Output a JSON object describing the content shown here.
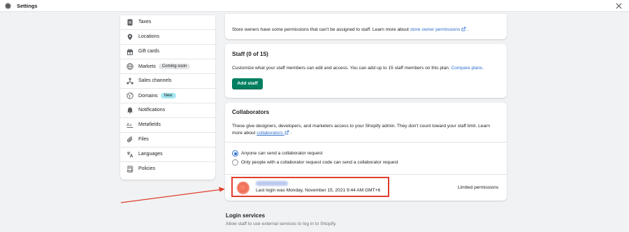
{
  "header": {
    "title": "Settings"
  },
  "sidebar": {
    "items": [
      {
        "label": "Taxes",
        "badge": null
      },
      {
        "label": "Locations",
        "badge": null
      },
      {
        "label": "Gift cards",
        "badge": null
      },
      {
        "label": "Markets",
        "badge": "Coming soon"
      },
      {
        "label": "Sales channels",
        "badge": null
      },
      {
        "label": "Domains",
        "badge": "New"
      },
      {
        "label": "Notifications",
        "badge": null
      },
      {
        "label": "Metafields",
        "badge": null
      },
      {
        "label": "Files",
        "badge": null
      },
      {
        "label": "Languages",
        "badge": null
      },
      {
        "label": "Policies",
        "badge": null
      }
    ]
  },
  "owner_card": {
    "text": "Store owners have some permissions that can't be assigned to staff. Learn more about",
    "link": "store owner permissions",
    "suffix": "."
  },
  "staff_card": {
    "title": "Staff (0 of 15)",
    "text": "Customize what your staff members can edit and access. You can add up to 15 staff members on this plan.",
    "link": "Compare plans.",
    "button": "Add staff"
  },
  "collaborators_card": {
    "title": "Collaborators",
    "desc_line1": "These give designers, developers, and marketers access to your Shopify admin. They don't count toward your staff limit. Learn",
    "desc_line2": "more about",
    "link": "collaborators",
    "suffix": ".",
    "options": [
      {
        "label": "Anyone can send a collaborator request",
        "selected": true
      },
      {
        "label": "Only people with a collaborator request code can send a collaborator request",
        "selected": false
      }
    ],
    "collaborator": {
      "last_login": "Last login was Monday, November 15, 2021 9:44 AM GMT+6",
      "permissions": "Limited permissions"
    }
  },
  "login_services": {
    "title": "Login services",
    "subtitle": "Allow staff to use external services to log in to Shopify."
  },
  "colors": {
    "accent": "#008060",
    "link": "#2c6ecb",
    "highlight": "#e03e2d"
  },
  "icons": [
    "gear-icon",
    "close-icon",
    "taxes-icon",
    "location-pin-icon",
    "gift-icon",
    "globe-icon",
    "sales-channels-icon",
    "domains-globe-icon",
    "bell-icon",
    "metafields-icon",
    "paperclip-icon",
    "languages-icon",
    "policies-icon",
    "external-link-icon",
    "annotation-arrow"
  ]
}
